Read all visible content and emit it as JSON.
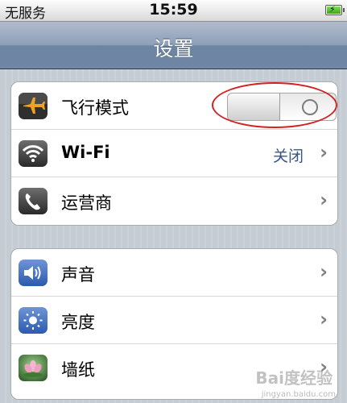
{
  "status_bar": {
    "carrier": "无服务",
    "time": "15:59",
    "battery_icon": "battery-charging-icon"
  },
  "nav": {
    "title": "设置"
  },
  "groups": [
    {
      "rows": [
        {
          "icon": "airplane-icon",
          "label": "飞行模式",
          "control": "toggle",
          "toggle_on": false
        },
        {
          "icon": "wifi-icon",
          "label": "Wi-Fi",
          "value": "关闭"
        },
        {
          "icon": "phone-icon",
          "label": "运营商"
        }
      ]
    },
    {
      "rows": [
        {
          "icon": "speaker-icon",
          "label": "声音"
        },
        {
          "icon": "sun-brightness-icon",
          "label": "亮度"
        },
        {
          "icon": "wallpaper-flower-icon",
          "label": "墙纸"
        }
      ]
    }
  ],
  "colors": {
    "accent_value": "#385487",
    "annotation": "#d32222",
    "airplane_icon_bg": "#333333",
    "airplane_glyph": "#f2a024"
  },
  "watermark": {
    "text": "Bai度经验",
    "sub": "jingyan.baidu.com"
  }
}
